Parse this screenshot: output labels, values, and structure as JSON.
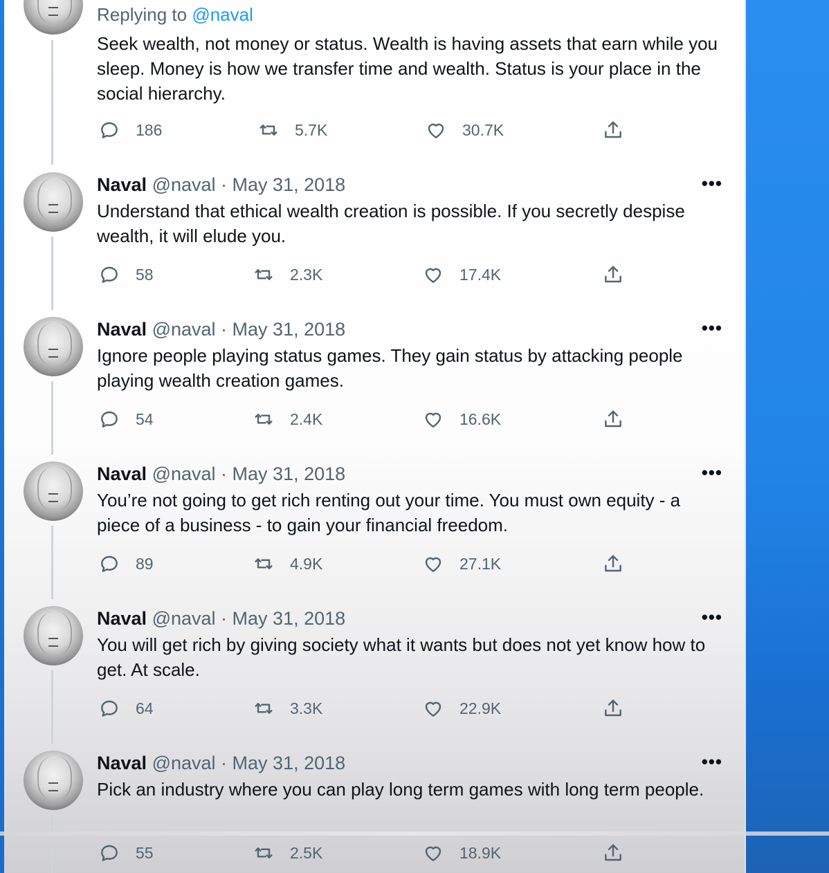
{
  "thread": {
    "top": {
      "replying_label": "Replying to",
      "replying_handle": "@naval",
      "text": "Seek wealth, not money or status. Wealth is having assets that earn while you sleep. Money is how we transfer time and wealth. Status is your place in the social hierarchy.",
      "replies": "186",
      "retweets": "5.7K",
      "likes": "30.7K"
    },
    "tweets": [
      {
        "name": "Naval",
        "handle": "@naval",
        "sep": " · ",
        "date": "May 31, 2018",
        "text": "Understand that ethical wealth creation is possible. If you secretly despise wealth, it will elude you.",
        "replies": "58",
        "retweets": "2.3K",
        "likes": "17.4K"
      },
      {
        "name": "Naval",
        "handle": "@naval",
        "sep": " · ",
        "date": "May 31, 2018",
        "text": "Ignore people playing status games. They gain status by attacking people playing wealth creation games.",
        "replies": "54",
        "retweets": "2.4K",
        "likes": "16.6K"
      },
      {
        "name": "Naval",
        "handle": "@naval",
        "sep": " · ",
        "date": "May 31, 2018",
        "text": "You’re not going to get rich renting out your time. You must own equity - a piece of a business - to gain your financial freedom.",
        "replies": "89",
        "retweets": "4.9K",
        "likes": "27.1K"
      },
      {
        "name": "Naval",
        "handle": "@naval",
        "sep": " · ",
        "date": "May 31, 2018",
        "text": "You will get rich by giving society what it wants but does not yet know how to get. At scale.",
        "replies": "64",
        "retweets": "3.3K",
        "likes": "22.9K"
      },
      {
        "name": "Naval",
        "handle": "@naval",
        "sep": " · ",
        "date": "May 31, 2018",
        "text": "Pick an industry where you can play long term games with long term people.",
        "replies": "55",
        "retweets": "2.5K",
        "likes": "18.9K"
      }
    ],
    "more_label": "•••",
    "icons": [
      "reply-icon",
      "retweet-icon",
      "like-icon",
      "share-icon"
    ]
  }
}
